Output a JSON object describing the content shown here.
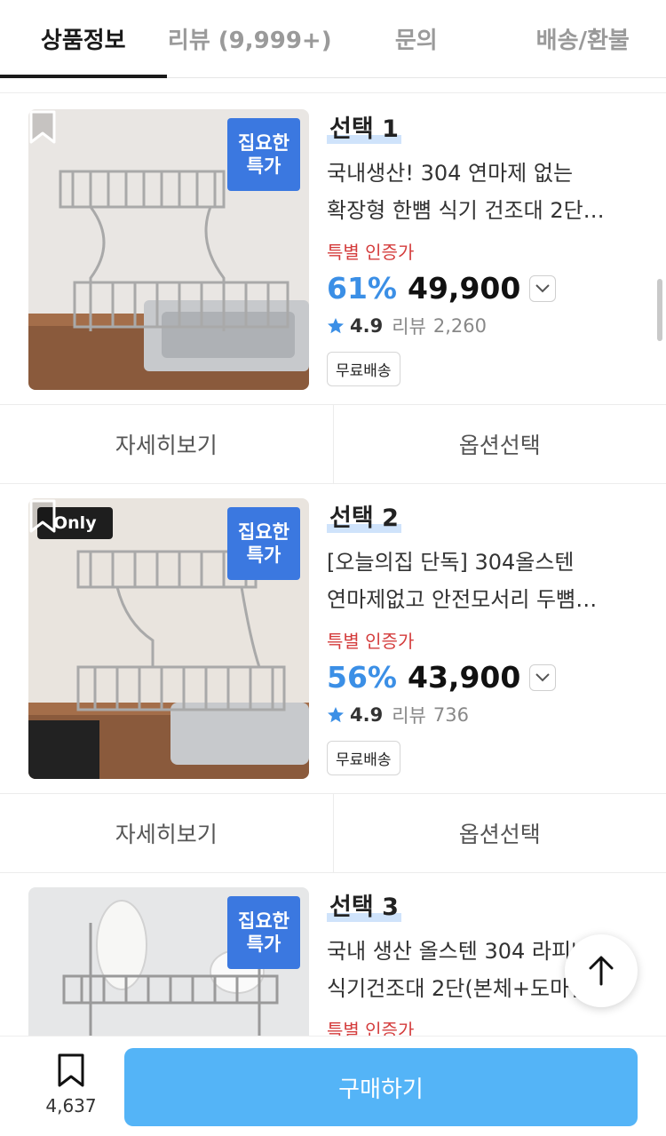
{
  "tabs": [
    {
      "label": "상품정보",
      "active": true
    },
    {
      "label": "리뷰 (9,999+)",
      "active": false
    },
    {
      "label": "문의",
      "active": false
    },
    {
      "label": "배송/환불",
      "active": false
    }
  ],
  "products": [
    {
      "selection": "선택 1",
      "deal_badge": [
        "집요한",
        "특가"
      ],
      "title_lines": [
        "국내생산! 304 연마제 없는",
        "확장형 한뼘 식기 건조대 2단…"
      ],
      "special": "특별 인증가",
      "discount": "61%",
      "price": "49,900",
      "rating": "4.9",
      "review_label": "리뷰",
      "review_count": "2,260",
      "shipping": "무료배송"
    },
    {
      "selection": "선택 2",
      "only_badge": "Only",
      "deal_badge": [
        "집요한",
        "특가"
      ],
      "title_lines": [
        "[오늘의집 단독] 304올스텐",
        "연마제없고 안전모서리 두뼘…"
      ],
      "special": "특별 인증가",
      "discount": "56%",
      "price": "43,900",
      "rating": "4.9",
      "review_label": "리뷰",
      "review_count": "736",
      "shipping": "무료배송"
    },
    {
      "selection": "선택 3",
      "deal_badge": [
        "집요한",
        "특가"
      ],
      "title_lines": [
        "국내 생산 올스텐 304 라피네",
        "식기건조대 2단(본체+도마걸…"
      ],
      "special": "특별 인증가"
    }
  ],
  "actions": {
    "detail": "자세히보기",
    "option": "옵션선택"
  },
  "bottom": {
    "bookmark_count": "4,637",
    "buy_label": "구매하기"
  },
  "colors": {
    "accent_blue": "#3b8fe6",
    "buy_button": "#54b4f7",
    "deal_badge": "#3b78e0",
    "special_red": "#d43c3c"
  }
}
